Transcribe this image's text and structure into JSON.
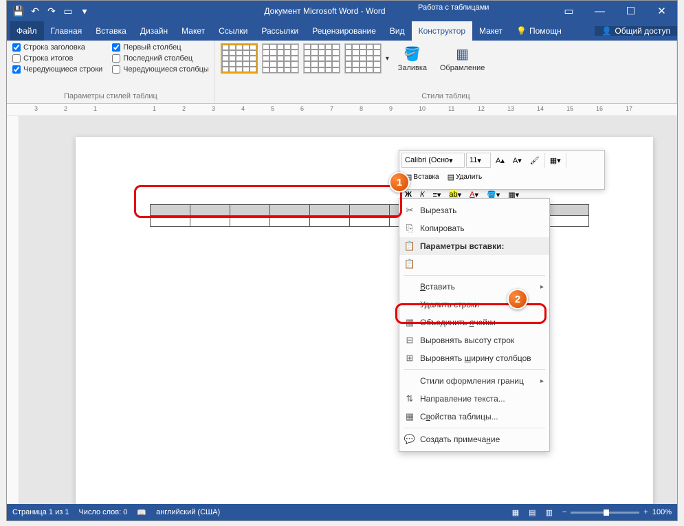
{
  "title": "Документ Microsoft Word - Word",
  "table_tools": "Работа с таблицами",
  "tabs": {
    "file": "Файл",
    "home": "Главная",
    "insert": "Вставка",
    "design": "Дизайн",
    "layout": "Макет",
    "refs": "Ссылки",
    "mail": "Рассылки",
    "review": "Рецензирование",
    "view": "Вид",
    "constructor": "Конструктор",
    "layout2": "Макет",
    "tell": "Помощн",
    "share": "Общий доступ"
  },
  "style_opts": {
    "header_row": "Строка заголовка",
    "total_row": "Строка итогов",
    "banded_rows": "Чередующиеся строки",
    "first_col": "Первый столбец",
    "last_col": "Последний столбец",
    "banded_cols": "Чередующиеся столбцы",
    "group": "Параметры стилей таблиц"
  },
  "styles_group": "Стили таблиц",
  "fill": "Заливка",
  "borders": "Обрамление",
  "mini": {
    "font": "Calibri (Осно",
    "size": "11",
    "insert": "Вставка",
    "delete": "Удалить"
  },
  "ctx": {
    "cut": "Вырезать",
    "copy": "Копировать",
    "paste_opts": "Параметры вставки:",
    "insert": "Вставить",
    "del_rows": "Удалить строки",
    "merge": "Объединить ячейки",
    "dist_rows": "Выровнять высоту строк",
    "dist_cols": "Выровнять ширину столбцов",
    "border_styles": "Стили оформления границ",
    "text_dir": "Направление текста...",
    "props": "Свойства таблицы...",
    "comment": "Создать примечание"
  },
  "status": {
    "page": "Страница 1 из 1",
    "words": "Число слов: 0",
    "lang": "английский (США)",
    "zoom": "100%"
  },
  "badges": {
    "one": "1",
    "two": "2"
  },
  "ruler_marks": [
    "3",
    "2",
    "1",
    "",
    "1",
    "2",
    "3",
    "4",
    "5",
    "6",
    "7",
    "8",
    "9",
    "10",
    "11",
    "12",
    "13",
    "14",
    "15",
    "16",
    "17"
  ]
}
